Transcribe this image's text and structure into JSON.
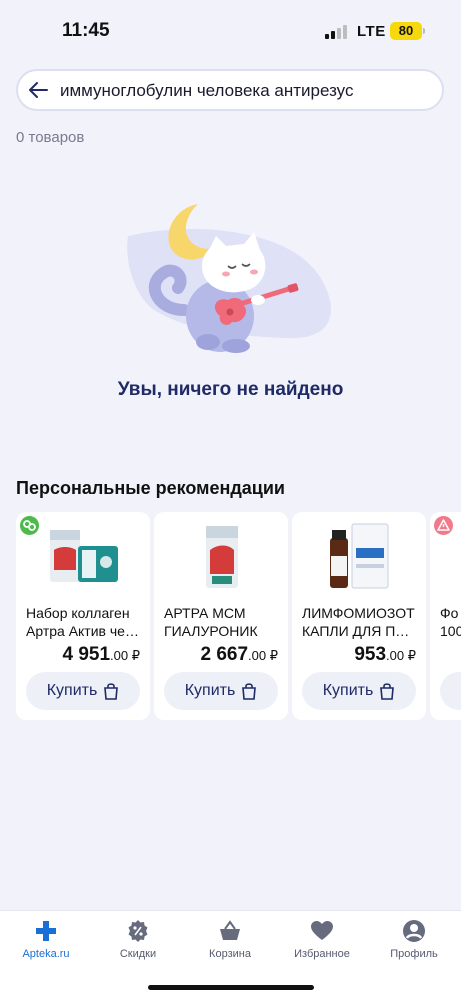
{
  "status_bar": {
    "time": "11:45",
    "network": "LTE",
    "battery": "80"
  },
  "search": {
    "query": "иммуноглобулин человека антирезус",
    "back_icon": "arrow-left-icon"
  },
  "result_count": "0 товаров",
  "empty_state": {
    "title": "Увы, ничего не найдено",
    "illustration": "cat-with-guitar-moon"
  },
  "recommendations": {
    "title": "Персональные рекомендации",
    "products": [
      {
        "name_line1": "Набор коллаген",
        "name_line2": "Артра Актив че…",
        "price_main": "4 951",
        "price_cents": ".00 ₽",
        "buy_label": "Купить",
        "badge": "link-badge-icon",
        "badge_color": "#4cbb4c"
      },
      {
        "name_line1": "АРТРА МСМ",
        "name_line2": "ГИАЛУРОНИК",
        "price_main": "2 667",
        "price_cents": ".00 ₽",
        "buy_label": "Купить"
      },
      {
        "name_line1": "ЛИМФОМИОЗОТ",
        "name_line2": "КАПЛИ ДЛЯ ПР…",
        "price_main": "953",
        "price_cents": ".00 ₽",
        "buy_label": "Купить"
      },
      {
        "name_line1": "Фо",
        "name_line2": "100",
        "badge": "warning-badge-icon",
        "badge_color": "#f07a8a"
      }
    ]
  },
  "bottom_nav": {
    "items": [
      {
        "label": "Apteka.ru",
        "icon": "cross-icon",
        "active": true
      },
      {
        "label": "Скидки",
        "icon": "discount-icon"
      },
      {
        "label": "Корзина",
        "icon": "basket-icon"
      },
      {
        "label": "Избранное",
        "icon": "heart-icon"
      },
      {
        "label": "Профиль",
        "icon": "profile-icon"
      }
    ]
  },
  "colors": {
    "background": "#f2f3fa",
    "accent": "#1a6fd6",
    "title": "#1f2a66",
    "battery": "#f5d90a"
  }
}
